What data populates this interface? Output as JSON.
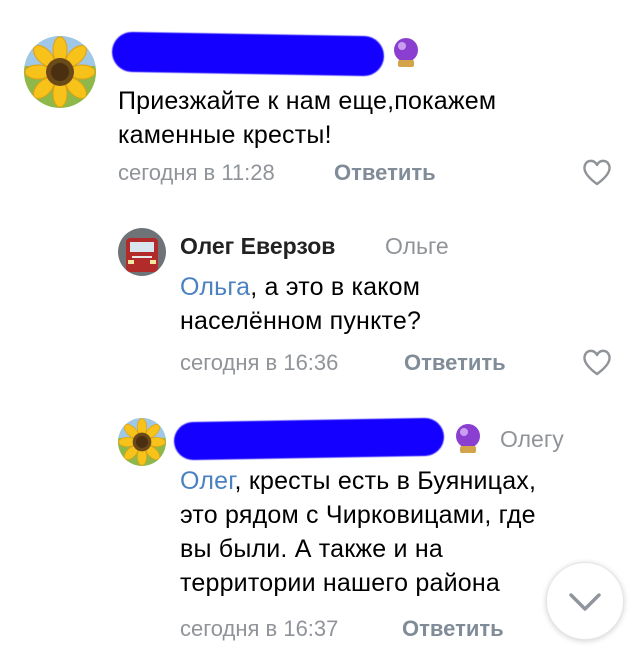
{
  "comments": [
    {
      "text": "Приезжайте к нам еще,покажем каменные кресты!",
      "text_line1": "Приезжайте к нам еще,покажем",
      "text_line2": "каменные кресты!",
      "time": "сегодня в 11:28",
      "reply_label": "Ответить",
      "avatar_icon": "sunflower-avatar",
      "badge_icon": "crystal-ball-icon"
    },
    {
      "author": "Олег Еверзов",
      "reply_to": "Ольге",
      "mention": "Ольга",
      "text_after_mention": ", а это в каком",
      "text_line2": "населённом пункте?",
      "time": "сегодня в 16:36",
      "reply_label": "Ответить",
      "avatar_icon": "train-avatar"
    },
    {
      "reply_to": "Олегу",
      "mention": "Олег",
      "text_after_mention": ", кресты есть в Буяницах,",
      "text_line2": "это рядом с Чирковицами, где",
      "text_line3": "вы были. А также и на",
      "text_line4": "территории нашего района",
      "time": "сегодня в 16:37",
      "reply_label": "Ответить",
      "avatar_icon": "sunflower-avatar",
      "badge_icon": "crystal-ball-icon"
    }
  ],
  "icons": {
    "like": "heart-icon",
    "scroll_down": "chevron-down-icon"
  },
  "colors": {
    "link": "#4a82c1",
    "meta": "#909499",
    "redaction": "#1400ff"
  }
}
